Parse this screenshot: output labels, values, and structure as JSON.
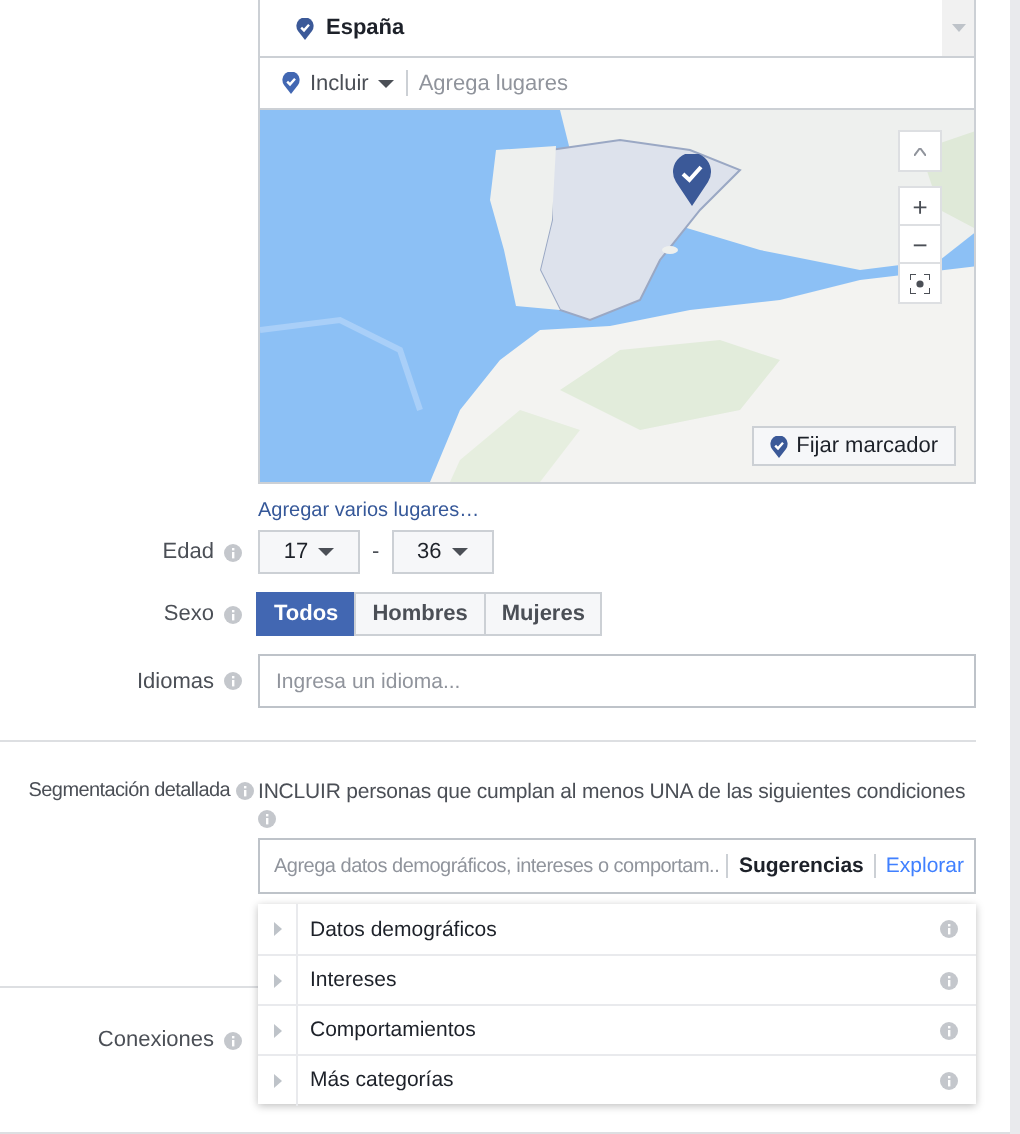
{
  "location": {
    "selected_place": "España",
    "include_dropdown": "Incluir",
    "places_placeholder": "Agrega lugares"
  },
  "map": {
    "kind": "picture",
    "zoom_in": "+",
    "zoom_out": "−",
    "pin_button": "Fijar marcador"
  },
  "add_places_link": "Agregar varios lugares…",
  "age": {
    "label": "Edad",
    "min": "17",
    "separator": "-",
    "max": "36"
  },
  "gender": {
    "label": "Sexo",
    "options": [
      {
        "label": "Todos",
        "selected": true
      },
      {
        "label": "Hombres",
        "selected": false
      },
      {
        "label": "Mujeres",
        "selected": false
      }
    ]
  },
  "languages": {
    "label": "Idiomas",
    "placeholder": "Ingresa un idioma..."
  },
  "detailed_targeting": {
    "label": "Segmentación detallada",
    "description": "INCLUIR personas que cumplan al menos UNA de las siguientes condiciones",
    "placeholder": "Agrega datos demográficos, intereses o comportam..",
    "tabs": [
      {
        "label": "Sugerencias",
        "selected": false
      },
      {
        "label": "Explorar",
        "selected": true
      }
    ],
    "categories": [
      {
        "label": "Datos demográficos",
        "expanded": false
      },
      {
        "label": "Intereses",
        "expanded": false
      },
      {
        "label": "Comportamientos",
        "expanded": false
      },
      {
        "label": "Más categorías",
        "expanded": false
      }
    ]
  },
  "connections": {
    "label": "Conexiones"
  }
}
